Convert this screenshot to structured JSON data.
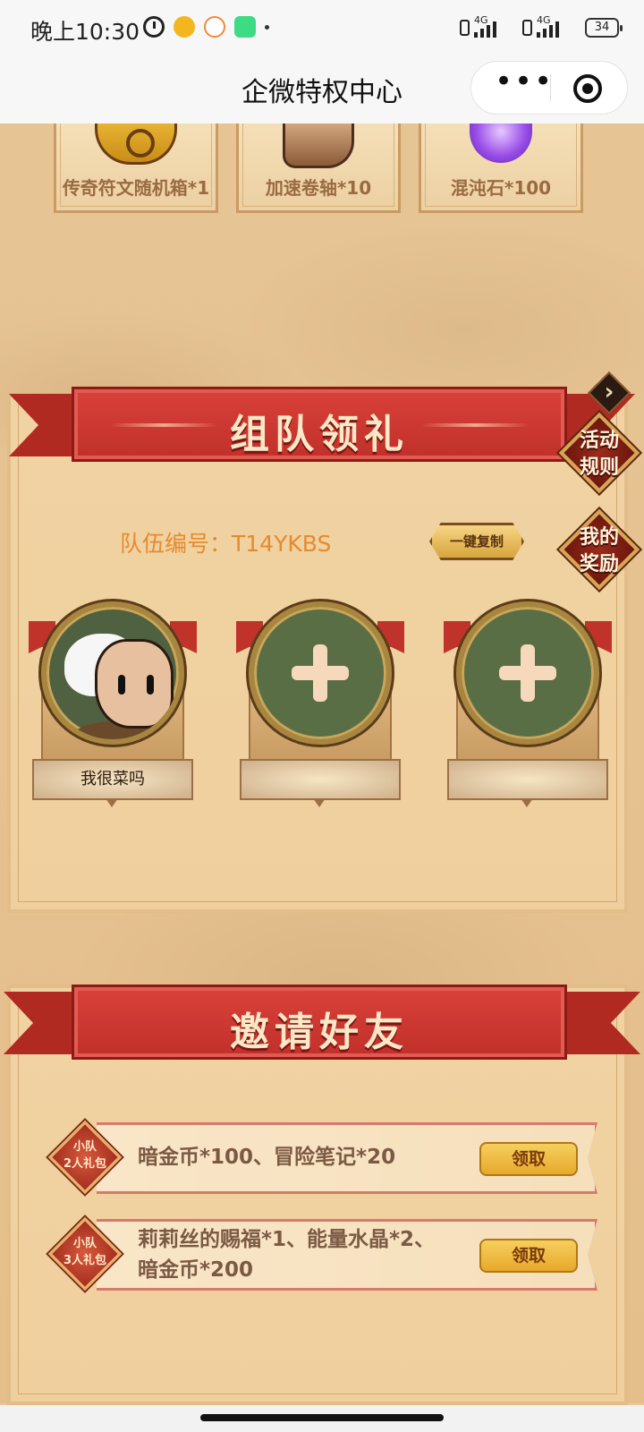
{
  "status_bar": {
    "time": "晚上10:30",
    "network1": "4G",
    "network2": "4G",
    "battery": "34"
  },
  "header": {
    "title": "企微特权中心",
    "more_label": "•••"
  },
  "top_rewards": [
    {
      "label": "传奇符文随机箱*1",
      "icon": "rune-bag-icon"
    },
    {
      "label": "加速卷轴*10",
      "icon": "scroll-icon"
    },
    {
      "label": "混沌石*100",
      "icon": "chaos-stone-icon"
    }
  ],
  "team_section": {
    "title": "组队领礼",
    "team_id_text": "队伍编号：T14YKBS",
    "copy_label": "一键复制",
    "members": [
      {
        "name": "我很菜吗"
      },
      {
        "name": ""
      },
      {
        "name": ""
      }
    ]
  },
  "side_buttons": {
    "rules_line1": "活动",
    "rules_line2": "规则",
    "rewards_line1": "我的",
    "rewards_line2": "奖励"
  },
  "invite_section": {
    "title": "邀请好友",
    "rows": [
      {
        "badge_line1": "小队",
        "badge_line2": "2人礼包",
        "desc": "暗金币*100、冒险笔记*20",
        "claim_label": "领取"
      },
      {
        "badge_line1": "小队",
        "badge_line2": "3人礼包",
        "desc": "莉莉丝的赐福*1、能量水晶*2、暗金币*200",
        "claim_label": "领取"
      }
    ]
  },
  "colors": {
    "ribbon_red": "#c0302a",
    "team_id_orange": "#e68a2e",
    "claim_gold": "#f7cf5e"
  }
}
